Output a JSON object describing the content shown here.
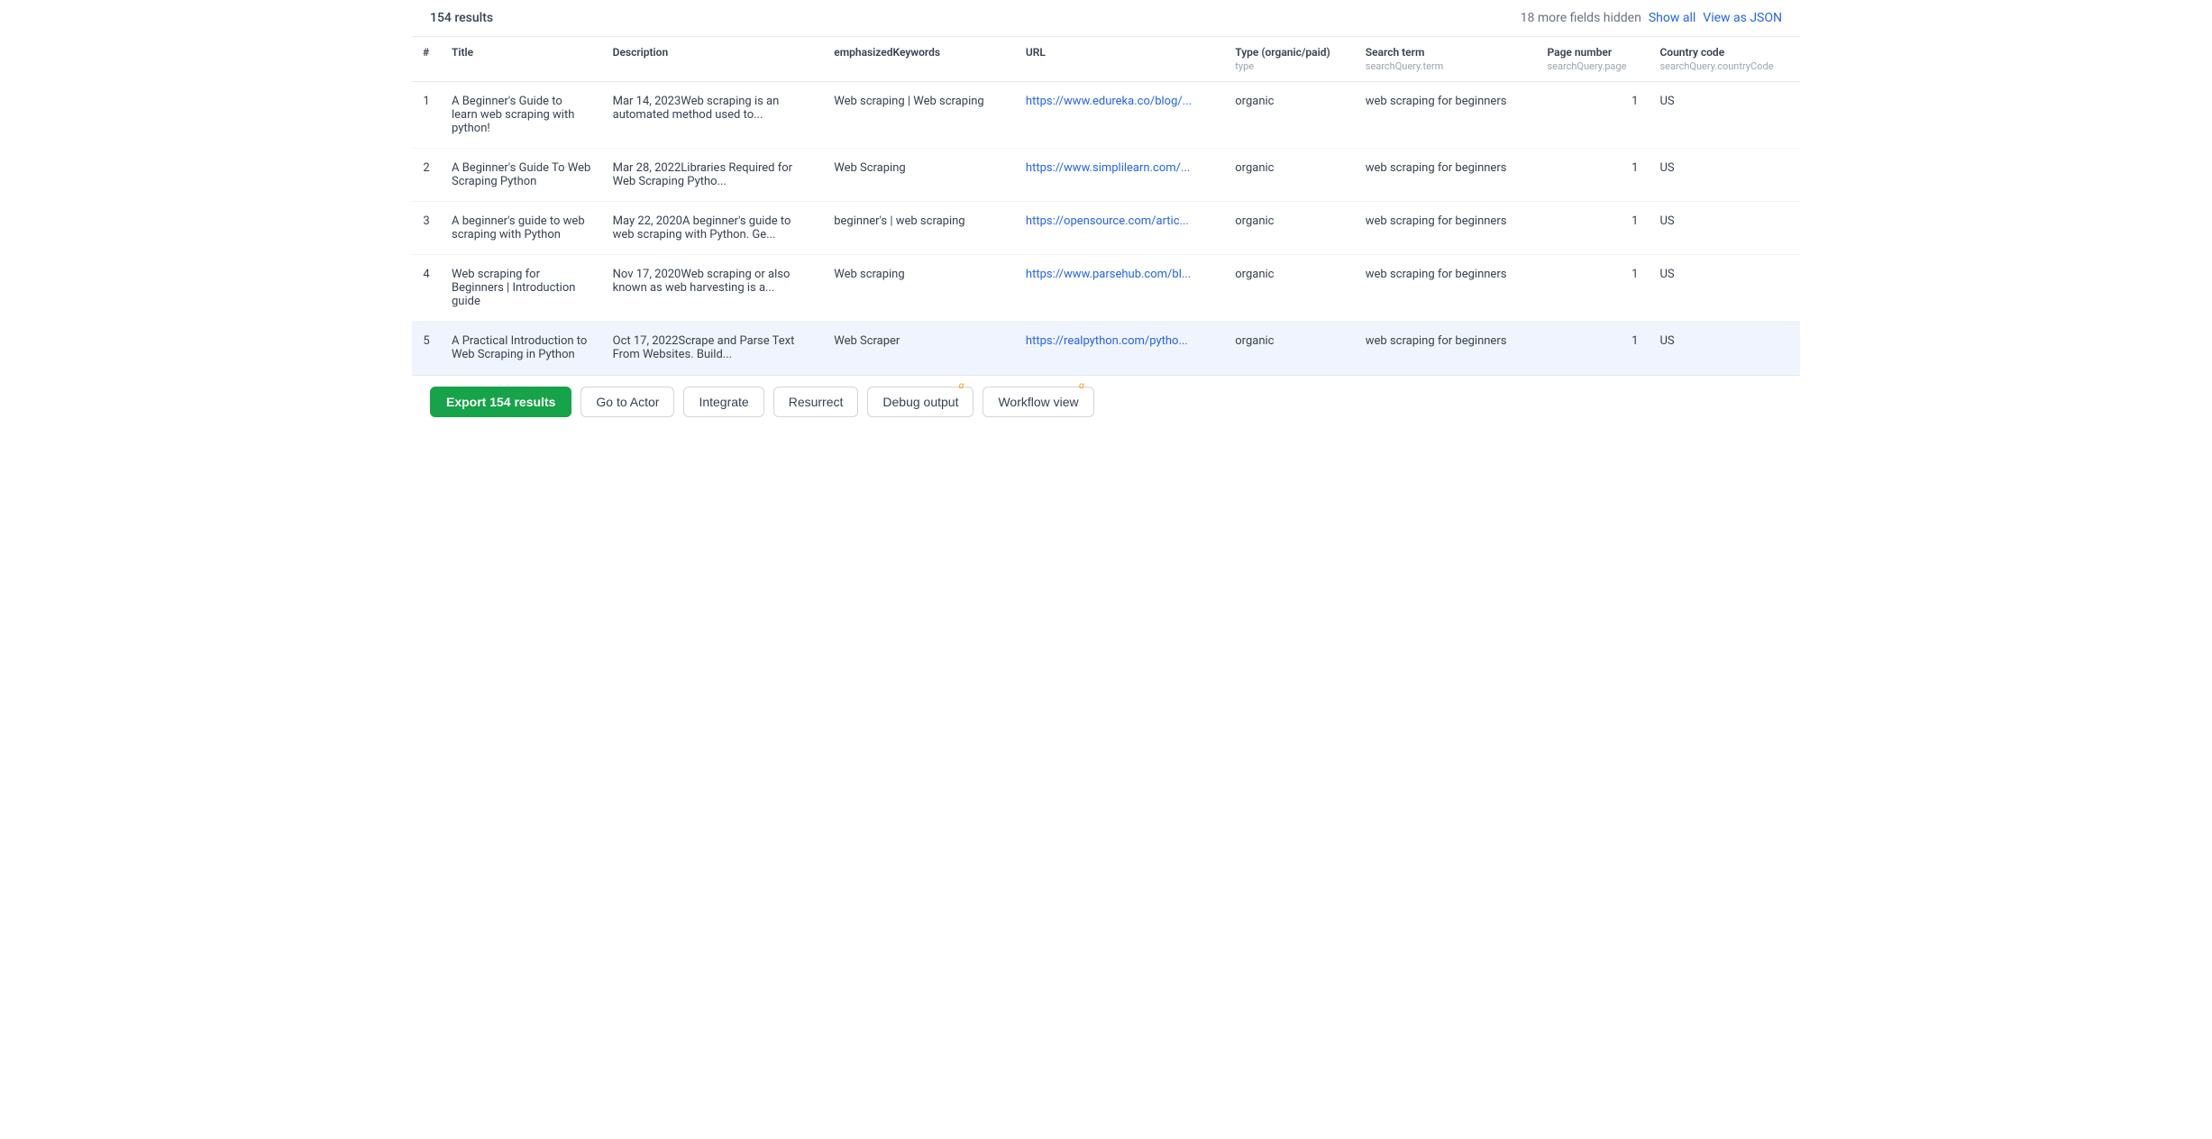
{
  "header": {
    "results_count": "154 results",
    "hidden_fields": "18 more fields hidden",
    "show_all_label": "Show all",
    "view_json_label": "View as JSON"
  },
  "table": {
    "columns": [
      {
        "id": "num",
        "label": "#",
        "sub": ""
      },
      {
        "id": "title",
        "label": "Title",
        "sub": ""
      },
      {
        "id": "description",
        "label": "Description",
        "sub": ""
      },
      {
        "id": "keywords",
        "label": "emphasizedKeywords",
        "sub": ""
      },
      {
        "id": "url",
        "label": "URL",
        "sub": ""
      },
      {
        "id": "type",
        "label": "Type (organic/paid)",
        "sub": "type"
      },
      {
        "id": "search_term",
        "label": "Search term",
        "sub": "searchQuery.term"
      },
      {
        "id": "page_number",
        "label": "Page number",
        "sub": "searchQuery.page"
      },
      {
        "id": "country_code",
        "label": "Country code",
        "sub": "searchQuery.countryCode"
      }
    ],
    "rows": [
      {
        "num": "1",
        "title": "A Beginner's Guide to learn web scraping with python!",
        "description": "Mar 14, 2023Web scraping is an automated method used to...",
        "keywords": "Web scraping | Web scraping",
        "url": "https://www.edureka.co/blog/...",
        "type": "organic",
        "search_term": "web scraping for beginners",
        "page_number": "1",
        "country_code": "US"
      },
      {
        "num": "2",
        "title": "A Beginner's Guide To Web Scraping Python",
        "description": "Mar 28, 2022Libraries Required for Web Scraping Pytho...",
        "keywords": "Web Scraping",
        "url": "https://www.simplilearn.com/...",
        "type": "organic",
        "search_term": "web scraping for beginners",
        "page_number": "1",
        "country_code": "US"
      },
      {
        "num": "3",
        "title": "A beginner's guide to web scraping with Python",
        "description": "May 22, 2020A beginner's guide to web scraping with Python. Ge...",
        "keywords": "beginner's | web scraping",
        "url": "https://opensource.com/artic...",
        "type": "organic",
        "search_term": "web scraping for beginners",
        "page_number": "1",
        "country_code": "US"
      },
      {
        "num": "4",
        "title": "Web scraping for Beginners | Introduction guide",
        "description": "Nov 17, 2020Web scraping or also known as web harvesting is a...",
        "keywords": "Web scraping",
        "url": "https://www.parsehub.com/bl...",
        "type": "organic",
        "search_term": "web scraping for beginners",
        "page_number": "1",
        "country_code": "US"
      },
      {
        "num": "5",
        "title": "A Practical Introduction to Web Scraping in Python",
        "description": "Oct 17, 2022Scrape and Parse Text From Websites. Build...",
        "keywords": "Web Scraper",
        "url": "https://realpython.com/pytho...",
        "type": "organic",
        "search_term": "web scraping for beginners",
        "page_number": "1",
        "country_code": "US"
      }
    ]
  },
  "footer": {
    "export_label": "Export 154 results",
    "go_to_actor_label": "Go to Actor",
    "integrate_label": "Integrate",
    "resurrect_label": "Resurrect",
    "debug_label": "Debug output",
    "workflow_label": "Workflow view",
    "alpha_badge": "α"
  }
}
